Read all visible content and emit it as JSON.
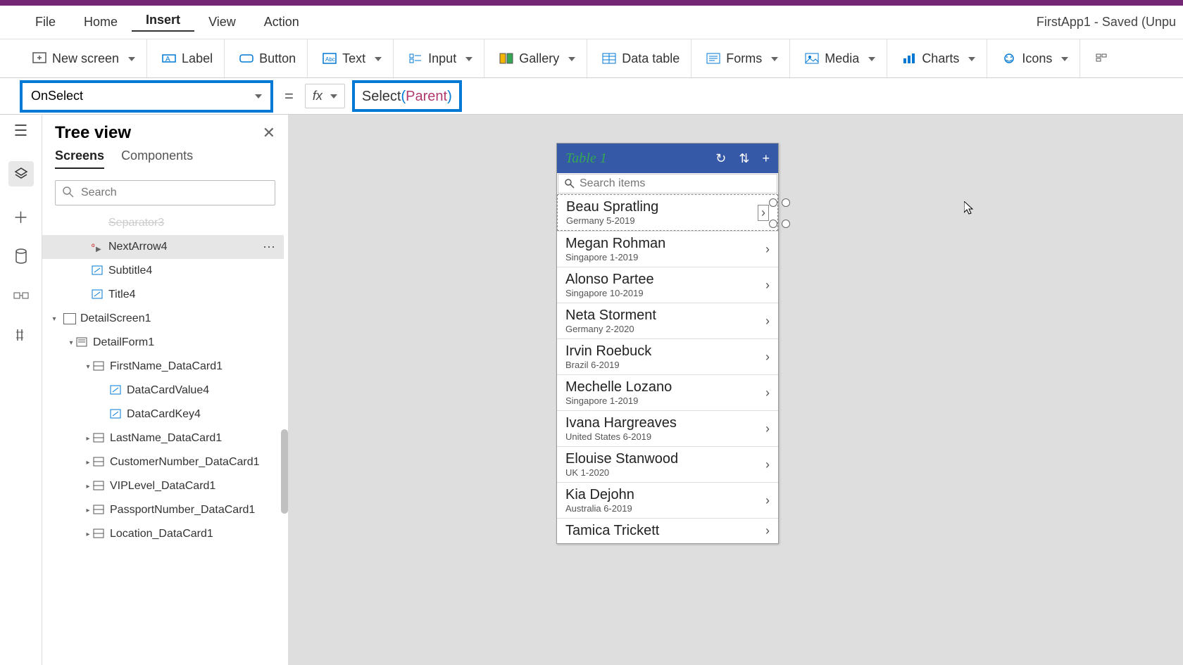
{
  "app_title": "FirstApp1 - Saved (Unpu",
  "menu": {
    "file": "File",
    "home": "Home",
    "insert": "Insert",
    "view": "View",
    "action": "Action"
  },
  "ribbon": {
    "new_screen": "New screen",
    "label": "Label",
    "button": "Button",
    "text": "Text",
    "input": "Input",
    "gallery": "Gallery",
    "data_table": "Data table",
    "forms": "Forms",
    "media": "Media",
    "charts": "Charts",
    "icons": "Icons"
  },
  "formula": {
    "property": "OnSelect",
    "fx": "fx",
    "equals": "=",
    "func": "Select",
    "open": "(",
    "arg": "Parent",
    "close": ")"
  },
  "tree": {
    "title": "Tree view",
    "tabs": {
      "screens": "Screens",
      "components": "Components"
    },
    "search_placeholder": "Search",
    "nodes": {
      "separator": "Separator3",
      "nextarrow": "NextArrow4",
      "subtitle": "Subtitle4",
      "title4": "Title4",
      "detailscreen": "DetailScreen1",
      "detailform": "DetailForm1",
      "firstname_dc": "FirstName_DataCard1",
      "dcvalue": "DataCardValue4",
      "dckey": "DataCardKey4",
      "lastname_dc": "LastName_DataCard1",
      "custnum_dc": "CustomerNumber_DataCard1",
      "vip_dc": "VIPLevel_DataCard1",
      "passport_dc": "PassportNumber_DataCard1",
      "location_dc": "Location_DataCard1"
    }
  },
  "phone": {
    "title": "Table 1",
    "search_placeholder": "Search items",
    "rows": [
      {
        "name": "Beau Spratling",
        "sub": "Germany 5-2019"
      },
      {
        "name": "Megan Rohman",
        "sub": "Singapore 1-2019"
      },
      {
        "name": "Alonso Partee",
        "sub": "Singapore 10-2019"
      },
      {
        "name": "Neta Storment",
        "sub": "Germany 2-2020"
      },
      {
        "name": "Irvin Roebuck",
        "sub": "Brazil 6-2019"
      },
      {
        "name": "Mechelle Lozano",
        "sub": "Singapore 1-2019"
      },
      {
        "name": "Ivana Hargreaves",
        "sub": "United States 6-2019"
      },
      {
        "name": "Elouise Stanwood",
        "sub": "UK 1-2020"
      },
      {
        "name": "Kia Dejohn",
        "sub": "Australia 6-2019"
      },
      {
        "name": "Tamica Trickett",
        "sub": ""
      }
    ]
  }
}
